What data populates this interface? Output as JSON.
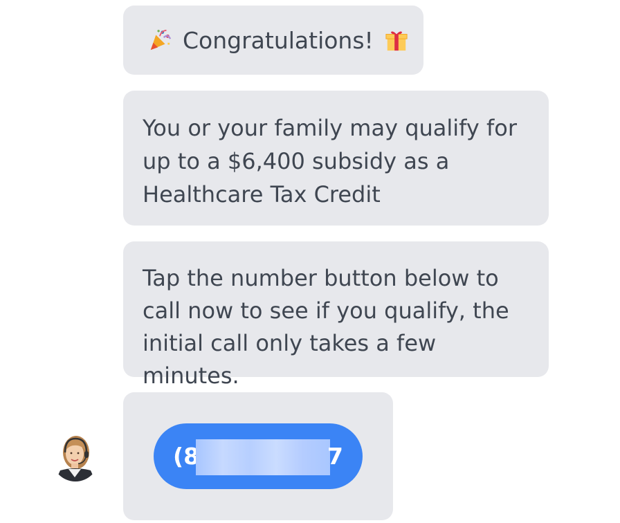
{
  "messages": [
    {
      "text": "Congratulations!",
      "emoji_before": "party-popper-icon",
      "emoji_after": "gift-icon"
    },
    {
      "text": "You or your family may qualify for up to a $6,400 subsidy as a Healthcare Tax Credit"
    },
    {
      "text": "Tap the number button below to call now to see if you qualify, the initial call only takes a few minutes."
    }
  ],
  "call_button": {
    "visible_prefix": "(8",
    "visible_suffix": "7",
    "redacted": true,
    "color": "#3b84f5"
  },
  "colors": {
    "bubble_bg": "#e7e8ec",
    "text": "#3f4651",
    "button_text": "#ffffff"
  }
}
